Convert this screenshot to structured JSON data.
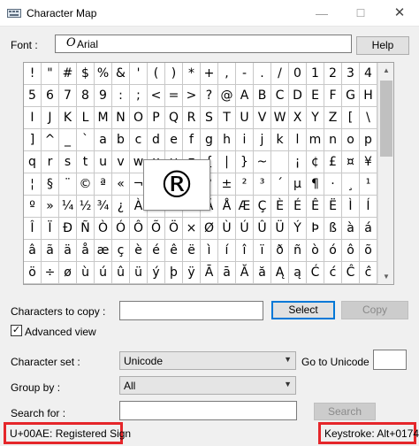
{
  "window": {
    "title": "Character Map",
    "min_glyph": "—",
    "max_glyph": "☐",
    "close_glyph": "✕"
  },
  "font": {
    "label": "Font :",
    "value": "Arial",
    "help_label": "Help"
  },
  "grid": {
    "cells": [
      "!",
      "\"",
      "#",
      "$",
      "%",
      "&",
      "'",
      "(",
      ")",
      "*",
      "+",
      ",",
      "-",
      ".",
      "/",
      "0",
      "1",
      "2",
      "3",
      "4",
      "5",
      "6",
      "7",
      "8",
      "9",
      ":",
      ";",
      "<",
      "=",
      ">",
      "?",
      "@",
      "A",
      "B",
      "C",
      "D",
      "E",
      "F",
      "G",
      "H",
      "I",
      "J",
      "K",
      "L",
      "M",
      "N",
      "O",
      "P",
      "Q",
      "R",
      "S",
      "T",
      "U",
      "V",
      "W",
      "X",
      "Y",
      "Z",
      "[",
      "\\",
      "]",
      "^",
      "_",
      "`",
      "a",
      "b",
      "c",
      "d",
      "e",
      "f",
      "g",
      "h",
      "i",
      "j",
      "k",
      "l",
      "m",
      "n",
      "o",
      "p",
      "q",
      "r",
      "s",
      "t",
      "u",
      "v",
      "w",
      "x",
      "y",
      "z",
      "{",
      "|",
      "}",
      "~",
      " ",
      "¡",
      "¢",
      "£",
      "¤",
      "¥",
      "¦",
      "§",
      "¨",
      "©",
      "ª",
      "«",
      "¬",
      "­",
      "®",
      "¯",
      "°",
      "±",
      "²",
      "³",
      "´",
      "µ",
      "¶",
      "·",
      "¸",
      "¹",
      "º",
      "»",
      "¼",
      "½",
      "¾",
      "¿",
      "À",
      "Á",
      "Â",
      "Ã",
      "Ä",
      "Å",
      "Æ",
      "Ç",
      "È",
      "É",
      "Ê",
      "Ë",
      "Ì",
      "Í",
      "Î",
      "Ï",
      "Ð",
      "Ñ",
      "Ò",
      "Ó",
      "Ô",
      "Õ",
      "Ö",
      "×",
      "Ø",
      "Ù",
      "Ú",
      "Û",
      "Ü",
      "Ý",
      "Þ",
      "ß",
      "à",
      "á",
      "â",
      "ã",
      "ä",
      "å",
      "æ",
      "ç",
      "è",
      "é",
      "ê",
      "ë",
      "ì",
      "í",
      "î",
      "ï",
      "ð",
      "ñ",
      "ò",
      "ó",
      "ô",
      "õ",
      "ö",
      "÷",
      "ø",
      "ù",
      "ú",
      "û",
      "ü",
      "ý",
      "þ",
      "ÿ",
      "Ā",
      "ā",
      "Ă",
      "ă",
      "Ą",
      "ą",
      "Ć",
      "ć",
      "Ĉ",
      "ĉ"
    ],
    "magnified_char": "®"
  },
  "copy": {
    "label": "Characters to copy :",
    "value": "",
    "select_label": "Select",
    "copy_label": "Copy"
  },
  "advanced": {
    "label": "Advanced view",
    "checked": true,
    "check_glyph": "✓"
  },
  "charset": {
    "label": "Character set :",
    "value": "Unicode"
  },
  "goto_unicode": {
    "label": "Go to Unicode :",
    "value": ""
  },
  "group_by": {
    "label": "Group by :",
    "value": "All"
  },
  "search": {
    "label": "Search for :",
    "value": "",
    "button_label": "Search"
  },
  "status": {
    "char_info": "U+00AE: Registered Sign",
    "keystroke": "Keystroke: Alt+0174"
  },
  "colors": {
    "highlight": "#e5262a",
    "focus": "#0078d7"
  }
}
